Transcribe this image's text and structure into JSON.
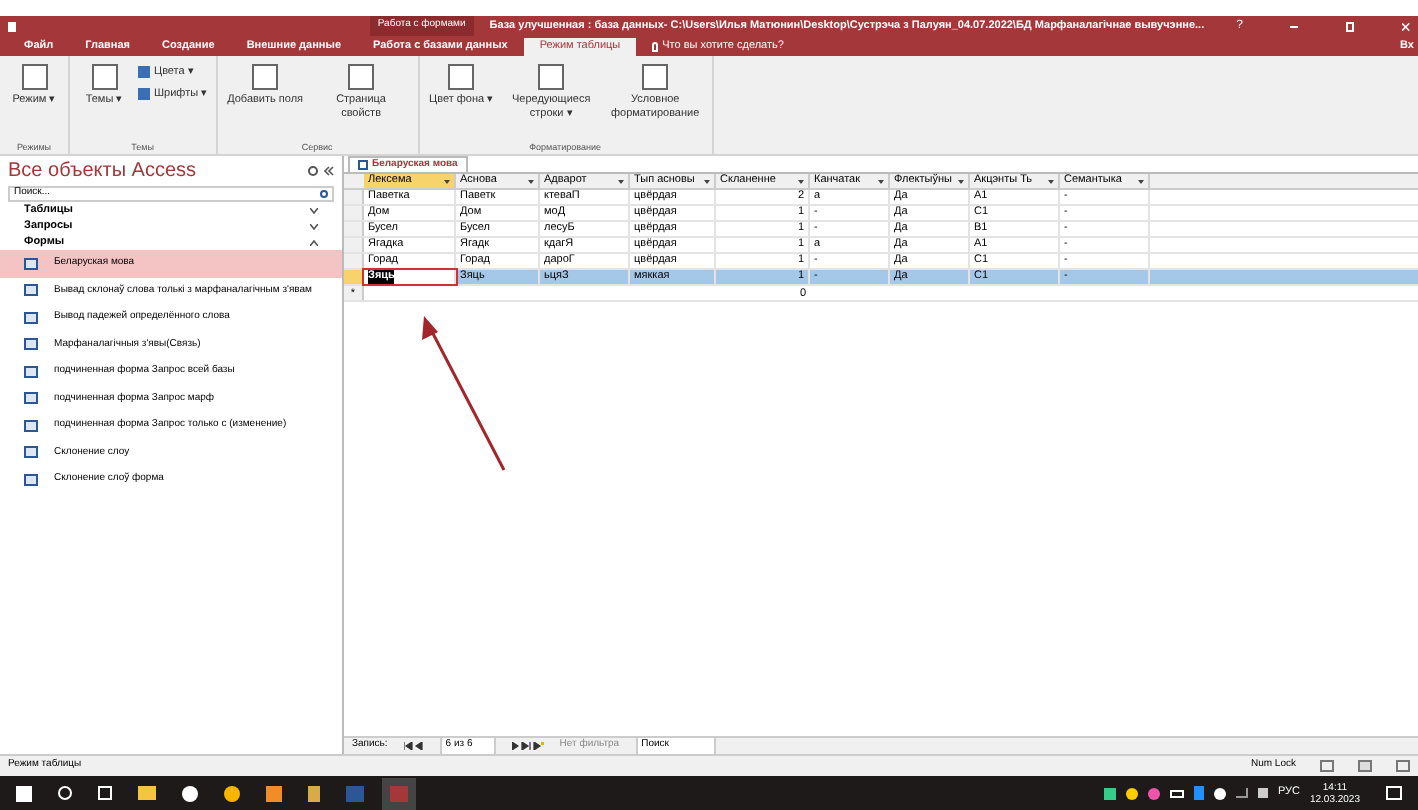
{
  "title_bar": {
    "context_label": "Работа с формами",
    "title": "База улучшенная : база данных- C:\\Users\\Илья Матюнин\\Desktop\\Сустрэча з Палуян_04.07.2022\\БД Марфаналагічнае вывучэнне...",
    "help": "?"
  },
  "tabs": [
    {
      "label": "Файл",
      "selected": false
    },
    {
      "label": "Главная",
      "selected": false
    },
    {
      "label": "Создание",
      "selected": false
    },
    {
      "label": "Внешние данные",
      "selected": false
    },
    {
      "label": "Работа с базами данных",
      "selected": false
    },
    {
      "label": "Режим таблицы",
      "selected": true
    }
  ],
  "tell_me": "Что вы хотите сделать?",
  "sign_in": "Вх",
  "ribbon_groups": [
    {
      "label": "Режимы",
      "buttons": [
        {
          "label": "Режим ▾"
        }
      ]
    },
    {
      "label": "Темы",
      "buttons": [
        {
          "label": "Темы ▾"
        }
      ],
      "small": [
        "Цвета ▾",
        "Шрифты ▾"
      ]
    },
    {
      "label": "Сервис",
      "buttons": [
        {
          "label": "Добавить поля"
        },
        {
          "label": "Страница свойств"
        }
      ]
    },
    {
      "label": "Форматирование",
      "buttons": [
        {
          "label": "Цвет фона ▾"
        },
        {
          "label": "Чередующиеся строки ▾"
        },
        {
          "label": "Условное форматирование"
        }
      ]
    }
  ],
  "nav_pane": {
    "title": "Все объекты Access",
    "search_placeholder": "Поиск...",
    "groups": [
      {
        "label": "Таблицы",
        "expanded": false
      },
      {
        "label": "Запросы",
        "expanded": false
      },
      {
        "label": "Формы",
        "expanded": true
      }
    ],
    "items": [
      {
        "label": "Беларуская мова",
        "selected": true
      },
      {
        "label": "Вывад склонаў слова толькі з марфаналагічным з'явам",
        "selected": false
      },
      {
        "label": "Вывод падежей определённого слова",
        "selected": false
      },
      {
        "label": "Марфаналагічныя з'явы(Связь)",
        "selected": false
      },
      {
        "label": "подчиненная форма Запрос всей базы",
        "selected": false
      },
      {
        "label": "подчиненная форма Запрос марф",
        "selected": false
      },
      {
        "label": "подчиненная форма Запрос только с (изменение)",
        "selected": false
      },
      {
        "label": "Склонение слоу",
        "selected": false
      },
      {
        "label": "Склонение слоў форма",
        "selected": false
      }
    ]
  },
  "document_tab": "Беларуская мова",
  "table": {
    "columns": [
      "Лексема",
      "Аснова",
      "Адварот",
      "Тып асновы",
      "Скланенне",
      "Канчатак",
      "Флектыўны",
      "Акцэнты Ть",
      "Семантыка"
    ],
    "rows": [
      {
        "cells": [
          "Паветка",
          "Паветк",
          "ктеваП",
          "цвёрдая",
          "2",
          "а",
          "Да",
          "А1",
          "-"
        ],
        "selected": false
      },
      {
        "cells": [
          "Дом",
          "Дом",
          "моД",
          "цвёрдая",
          "1",
          "-",
          "Да",
          "С1",
          "-"
        ],
        "selected": false
      },
      {
        "cells": [
          "Бусел",
          "Бусел",
          "лесуБ",
          "цвёрдая",
          "1",
          "-",
          "Да",
          "В1",
          "-"
        ],
        "selected": false
      },
      {
        "cells": [
          "Ягадка",
          "Ягадк",
          "кдагЯ",
          "цвёрдая",
          "1",
          "а",
          "Да",
          "А1",
          "-"
        ],
        "selected": false
      },
      {
        "cells": [
          "Горад",
          "Горад",
          "дароГ",
          "цвёрдая",
          "1",
          "-",
          "Да",
          "С1",
          "-"
        ],
        "selected": false
      },
      {
        "cells": [
          "Зяць",
          "Зяць",
          "ьцяЗ",
          "мяккая",
          "1",
          "-",
          "Да",
          "С1",
          "-"
        ],
        "selected": true
      }
    ],
    "new_row": {
      "marker": "*",
      "default_value": "0"
    }
  },
  "record_nav": {
    "label": "Запись:",
    "position": "6 из 6",
    "filter": "Нет фильтра",
    "search": "Поиск"
  },
  "status_bar": {
    "mode": "Режим таблицы",
    "num_lock": "Num Lock"
  },
  "taskbar": {
    "language": "РУС",
    "time": "14:11",
    "date": "12.03.2023"
  }
}
